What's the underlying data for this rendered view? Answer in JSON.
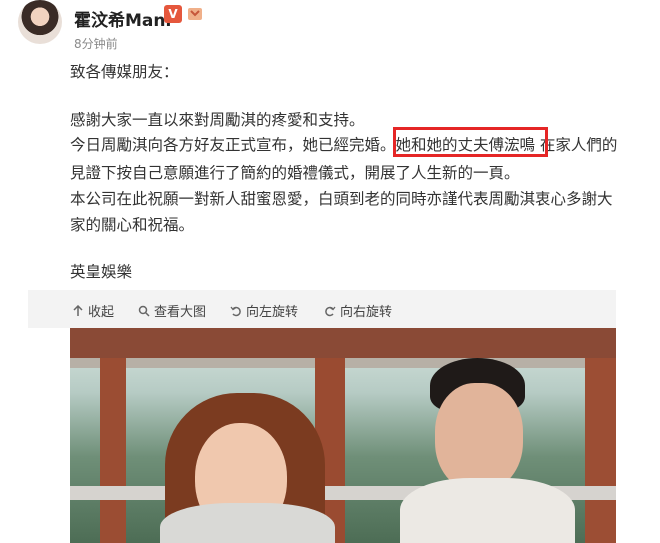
{
  "post": {
    "author": "霍汶希Mani",
    "verified_badge": "V",
    "timestamp": "8分钟前",
    "lines": [
      "致各傳媒朋友：",
      "感謝大家一直以來對周勵淇的疼愛和支持。",
      "今日周勵淇向各方好友正式宣布，她已經完婚。她和她的丈夫傅浤鳴 在家人們的",
      "見證下按自己意願進行了簡約的婚禮儀式，開展了人生新的一頁。",
      "本公司在此祝願一對新人甜蜜恩愛，白頭到老的同時亦謹代表周勵淇衷心多謝大",
      "家的關心和祝福。",
      "英皇娛樂"
    ]
  },
  "toolbar": {
    "collapse": "收起",
    "view_large": "查看大图",
    "rotate_left": "向左旋转",
    "rotate_right": "向右旋转"
  },
  "colors": {
    "highlight": "#e52626",
    "badge": "#e5573c"
  },
  "icons": [
    "up-arrow-icon",
    "magnifier-icon",
    "rotate-left-icon",
    "rotate-right-icon"
  ]
}
